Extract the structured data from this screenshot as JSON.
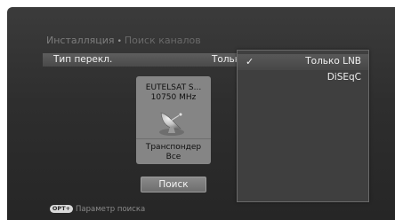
{
  "breadcrumb": {
    "level1": "Инсталляция",
    "separator": "•",
    "level2": "Поиск каналов"
  },
  "switch_row": {
    "label": "Тип перекл.",
    "value": "Тольк"
  },
  "dropdown": {
    "options": [
      {
        "label": "Только LNB",
        "selected": true
      },
      {
        "label": "DiSEqC",
        "selected": false
      }
    ],
    "check_glyph": "✓"
  },
  "satellite": {
    "name": "EUTELSAT S...",
    "frequency": "10750 MHz",
    "icon": "satellite-dish-icon",
    "transponder_label": "Транспондер",
    "transponder_value": "Все"
  },
  "search_button": {
    "label": "Поиск"
  },
  "hint": {
    "badge": "OPT+",
    "text": "Параметр поиска"
  },
  "colors": {
    "background": "#2e2e2e",
    "highlight_row": "#555555",
    "panel": "#858585",
    "text": "#f2f2f2"
  }
}
